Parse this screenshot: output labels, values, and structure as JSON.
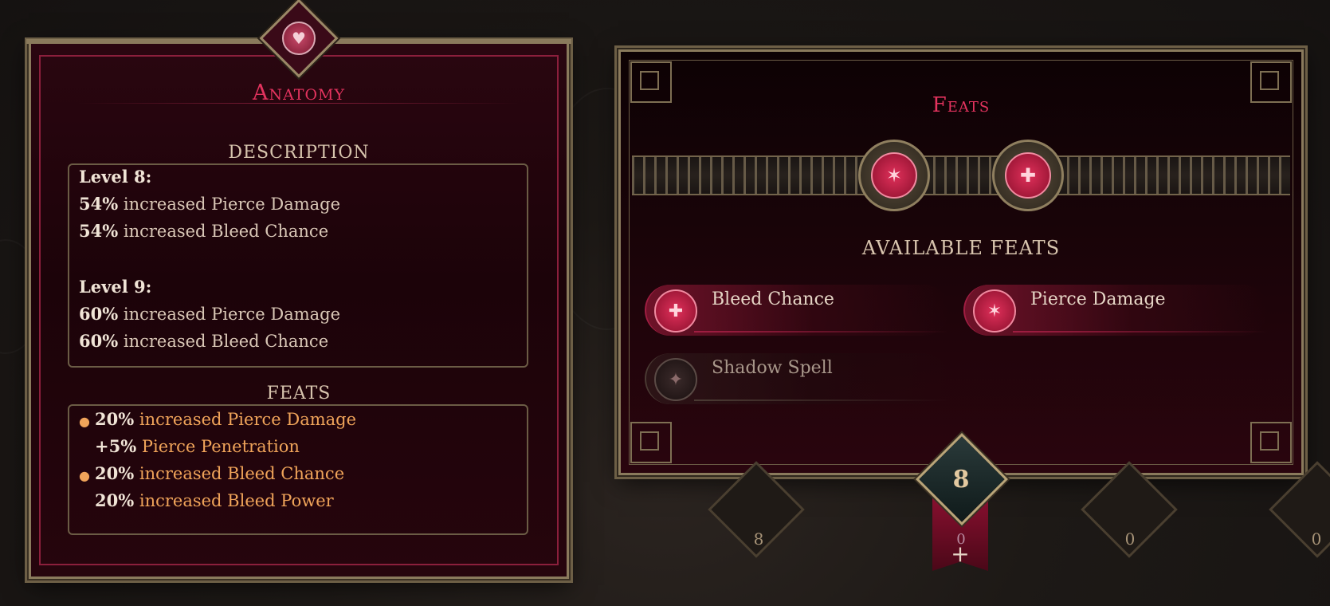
{
  "anatomy": {
    "title": "Anatomy",
    "description_label": "DESCRIPTION",
    "levels": [
      {
        "heading": "Level 8:",
        "lines": [
          {
            "value": "54%",
            "text": " increased Pierce Damage"
          },
          {
            "value": "54%",
            "text": " increased Bleed Chance"
          }
        ]
      },
      {
        "heading": "Level 9:",
        "lines": [
          {
            "value": "60%",
            "text": " increased Pierce Damage"
          },
          {
            "value": "60%",
            "text": " increased Bleed Chance"
          }
        ]
      }
    ],
    "feats_label": "FEATS",
    "feats": [
      {
        "bullet": true,
        "value": "20%",
        "text": " increased Pierce Damage"
      },
      {
        "bullet": false,
        "value": "+5%",
        "text": " Pierce Penetration"
      },
      {
        "bullet": true,
        "value": "20%",
        "text": " increased Bleed Chance"
      },
      {
        "bullet": false,
        "value": "20%",
        "text": " increased Bleed Power"
      }
    ]
  },
  "feats_panel": {
    "title": "Feats",
    "slot_icons": [
      "pierce-icon",
      "bleed-icon"
    ],
    "available_label": "AVAILABLE FEATS",
    "available": [
      {
        "name": "Bleed Chance",
        "icon": "bleed-icon",
        "active": true
      },
      {
        "name": "Pierce Damage",
        "icon": "pierce-icon",
        "active": true
      },
      {
        "name": "Shadow Spell",
        "icon": "shadow-icon",
        "active": false
      }
    ]
  },
  "bottom_bar": {
    "badges": [
      "8",
      "0",
      "0",
      "0"
    ],
    "selected_level": "8",
    "selected_points": "0",
    "add_symbol": "+"
  },
  "colors": {
    "accent": "#e3335e",
    "feat_text": "#f0a45a",
    "gold": "#8a7a5c"
  }
}
